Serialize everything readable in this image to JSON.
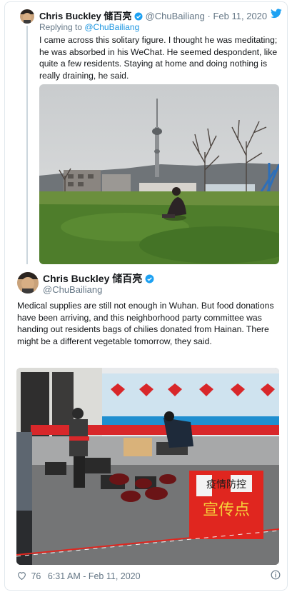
{
  "thread_tweet": {
    "author_name": "Chris Buckley 储百亮",
    "author_handle": "@ChuBailiang",
    "date": "Feb 11, 2020",
    "replying_prefix": "Replying to ",
    "replying_handle": "@ChuBailiang",
    "text": "I came across this solitary figure. I thought he was meditating; he was absorbed in his WeChat. He seemed despondent, like quite a few residents. Staying at home and doing nothing is really draining, he said."
  },
  "main_tweet": {
    "author_name": "Chris Buckley 储百亮",
    "author_handle": "@ChuBailiang",
    "text": "Medical supplies are still not enough in Wuhan. But food donations have been arriving, and this neighborhood party committee was handing out residents bags of chilies donated from Hainan. There might be a different vegetable tomorrow, they said.",
    "sign_small": "疫情防控",
    "sign_big": "宣传点",
    "likes": "76",
    "timestamp": "6:31 AM - Feb 11, 2020"
  },
  "icons": {
    "verified": "verified-badge-icon",
    "bird": "twitter-bird-icon",
    "heart": "heart-icon",
    "info": "info-icon"
  },
  "colors": {
    "verified": "#1da1f2",
    "link": "#1b95e0",
    "muted": "#657786",
    "sign_red": "#e0261f"
  }
}
